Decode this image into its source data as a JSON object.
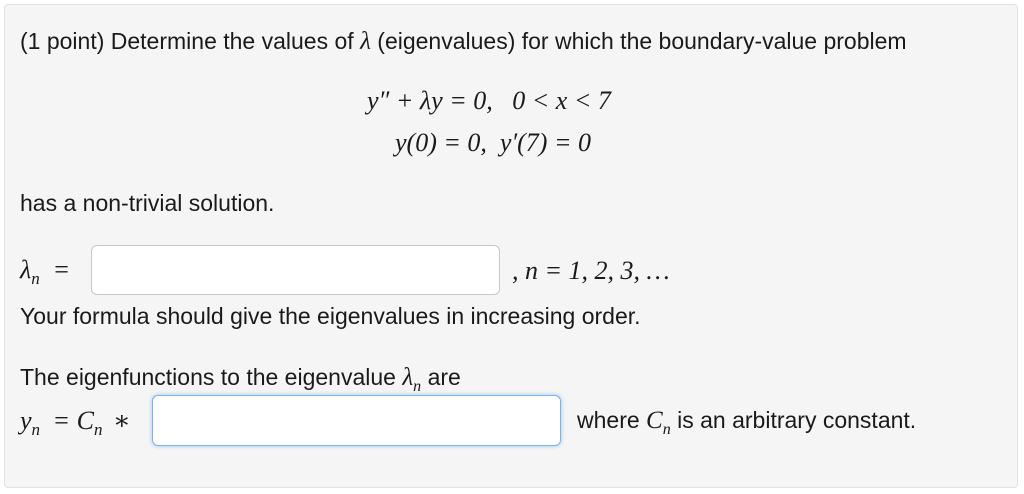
{
  "problem": {
    "intro_prefix": "(1 point) Determine the values of",
    "lambda_symbol": "λ",
    "intro_suffix": "(eigenvalues) for which the boundary-value problem",
    "equation_line1": "y″ + λy = 0,   0 < x < 7",
    "equation_line2": "y(0) = 0,  y′(7) = 0",
    "nontrivial_text": "has a non-trivial solution."
  },
  "eigenvalue_answer": {
    "lhs_symbol": "λ",
    "lhs_subscript": "n",
    "lhs_equals": "=",
    "input_value": "",
    "index_text": ", n = 1, 2, 3, …",
    "order_note": "Your formula should give the eigenvalues in increasing order."
  },
  "eigenfunction_answer": {
    "intro_text": "The eigenfunctions to the eigenvalue",
    "lambda_symbol": "λ",
    "lambda_subscript": "n",
    "intro_suffix": "are",
    "lhs_y": "y",
    "lhs_y_sub": "n",
    "lhs_mid": "= C",
    "lhs_c_sub": "n",
    "lhs_star": "∗",
    "input_value": "",
    "where_text": "where",
    "const_symbol": "C",
    "const_sub": "n",
    "const_suffix": "is an arbitrary constant."
  }
}
